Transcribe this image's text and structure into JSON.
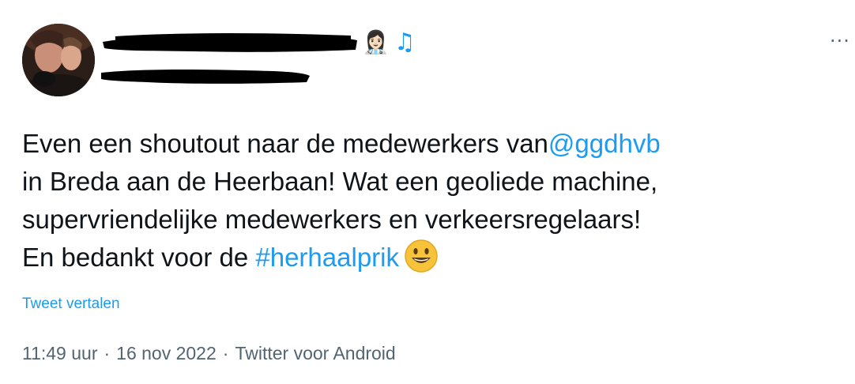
{
  "author": {
    "emoji": "👩🏻‍⚕️",
    "music_icon": "♫"
  },
  "more_icon": "···",
  "tweet": {
    "line1_text": "Even een shoutout naar de medewerkers van",
    "mention": "@ggdhvb",
    "line2": "in Breda aan de Heerbaan! Wat een geoliede machine,",
    "line3": "supervriendelijke medewerkers en verkeersregelaars!",
    "line4_text": "En bedankt voor de ",
    "hashtag": "#herhaalprik",
    "emoji_icon": "smiley-emoji"
  },
  "translate_label": "Tweet vertalen",
  "meta": {
    "time": "11:49 uur",
    "separator": "·",
    "date": "16 nov 2022",
    "source": "Twitter voor Android"
  },
  "colors": {
    "link": "#1d9bf0",
    "text": "#0f1419",
    "meta": "#536471"
  }
}
